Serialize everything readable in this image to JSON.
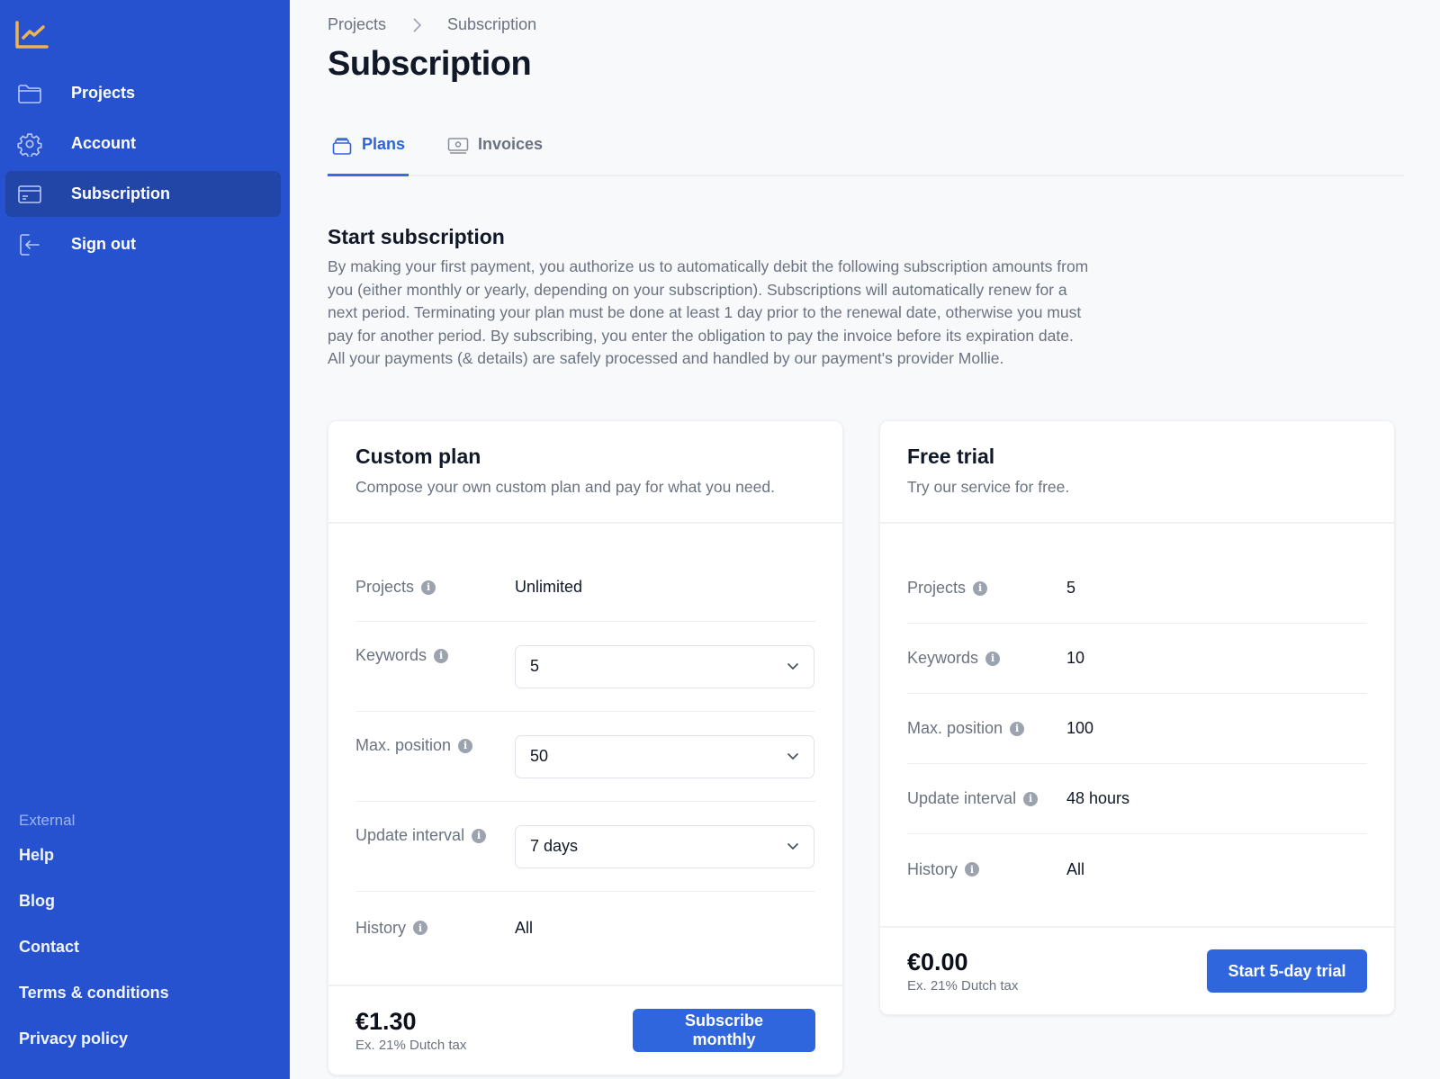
{
  "sidebar": {
    "nav": [
      {
        "label": "Projects",
        "icon": "folder-icon",
        "active": false
      },
      {
        "label": "Account",
        "icon": "gear-icon",
        "active": false
      },
      {
        "label": "Subscription",
        "icon": "credit-card-icon",
        "active": true
      },
      {
        "label": "Sign out",
        "icon": "sign-out-icon",
        "active": false
      }
    ],
    "external_title": "External",
    "external_links": [
      "Help",
      "Blog",
      "Contact",
      "Terms & conditions",
      "Privacy policy"
    ]
  },
  "breadcrumb": [
    "Projects",
    "Subscription"
  ],
  "page_title": "Subscription",
  "tabs": [
    {
      "label": "Plans",
      "icon": "stack-icon",
      "active": true
    },
    {
      "label": "Invoices",
      "icon": "cash-icon",
      "active": false
    }
  ],
  "section": {
    "title": "Start subscription",
    "description": "By making your first payment, you authorize us to automatically debit the following subscription amounts from you (either monthly or yearly, depending on your subscription). Subscriptions will automatically renew for a next period. Terminating your plan must be done at least 1 day prior to the renewal date, otherwise you must pay for another period. By subscribing, you enter the obligation to pay the invoice before its expiration date. All your payments (& details) are safely processed and handled by our payment's provider Mollie."
  },
  "custom_plan": {
    "title": "Custom plan",
    "subtitle": "Compose your own custom plan and pay for what you need.",
    "rows": [
      {
        "label": "Projects",
        "value": "Unlimited",
        "type": "text"
      },
      {
        "label": "Keywords",
        "value": "5",
        "type": "select"
      },
      {
        "label": "Max. position",
        "value": "50",
        "type": "select"
      },
      {
        "label": "Update interval",
        "value": "7 days",
        "type": "select"
      },
      {
        "label": "History",
        "value": "All",
        "type": "text"
      }
    ],
    "price": "€1.30",
    "tax_note": "Ex. 21% Dutch tax",
    "button": "Subscribe monthly"
  },
  "free_trial": {
    "title": "Free trial",
    "subtitle": "Try our service for free.",
    "rows": [
      {
        "label": "Projects",
        "value": "5"
      },
      {
        "label": "Keywords",
        "value": "10"
      },
      {
        "label": "Max. position",
        "value": "100"
      },
      {
        "label": "Update interval",
        "value": "48 hours"
      },
      {
        "label": "History",
        "value": "All"
      }
    ],
    "price": "€0.00",
    "tax_note": "Ex. 21% Dutch tax",
    "button": "Start 5-day trial"
  },
  "colors": {
    "sidebar_bg": "#2752cf",
    "sidebar_active": "#2245a8",
    "accent": "#2f66de",
    "logo": "#f0b34e"
  }
}
